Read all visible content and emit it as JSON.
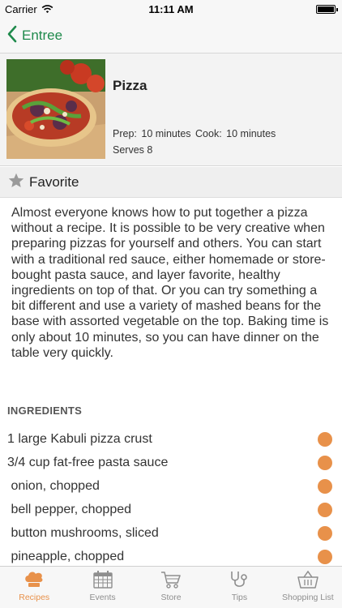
{
  "status_bar": {
    "carrier": "Carrier",
    "time": "11:11 AM"
  },
  "nav": {
    "back_label": "Entree"
  },
  "recipe": {
    "title": "Pizza",
    "prep_label": "Prep:",
    "prep_value": "10 minutes",
    "cook_label": "Cook:",
    "cook_value": "10 minutes",
    "serves": "Serves 8"
  },
  "favorite": {
    "label": "Favorite"
  },
  "description": "Almost everyone knows how to put together a pizza without a recipe. It is possible to be very creative when preparing pizzas for yourself and others. You can start with a traditional red sauce, either homemade or store-bought pasta sauce, and layer favorite, healthy ingredients on top of that. Or you can try something a bit different and use a variety of mashed beans for the base with assorted vegetable on the top. Baking time is only about 10 minutes, so you can have dinner on the table very quickly.",
  "ingredients": {
    "header": "INGREDIENTS",
    "items": [
      "1 large Kabuli pizza crust",
      "3/4 cup fat-free pasta sauce",
      " onion, chopped",
      " bell pepper, chopped",
      " button mushrooms, sliced",
      " pineapple, chopped"
    ]
  },
  "tabs": [
    {
      "label": "Recipes",
      "icon": "chef-hat-icon",
      "active": true
    },
    {
      "label": "Events",
      "icon": "calendar-icon",
      "active": false
    },
    {
      "label": "Store",
      "icon": "cart-icon",
      "active": false
    },
    {
      "label": "Tips",
      "icon": "stethoscope-icon",
      "active": false
    },
    {
      "label": "Shopping List",
      "icon": "basket-icon",
      "active": false
    }
  ],
  "colors": {
    "accent_green": "#1f8a4c",
    "accent_orange": "#e8914a",
    "tab_inactive": "#8e8e8e"
  }
}
